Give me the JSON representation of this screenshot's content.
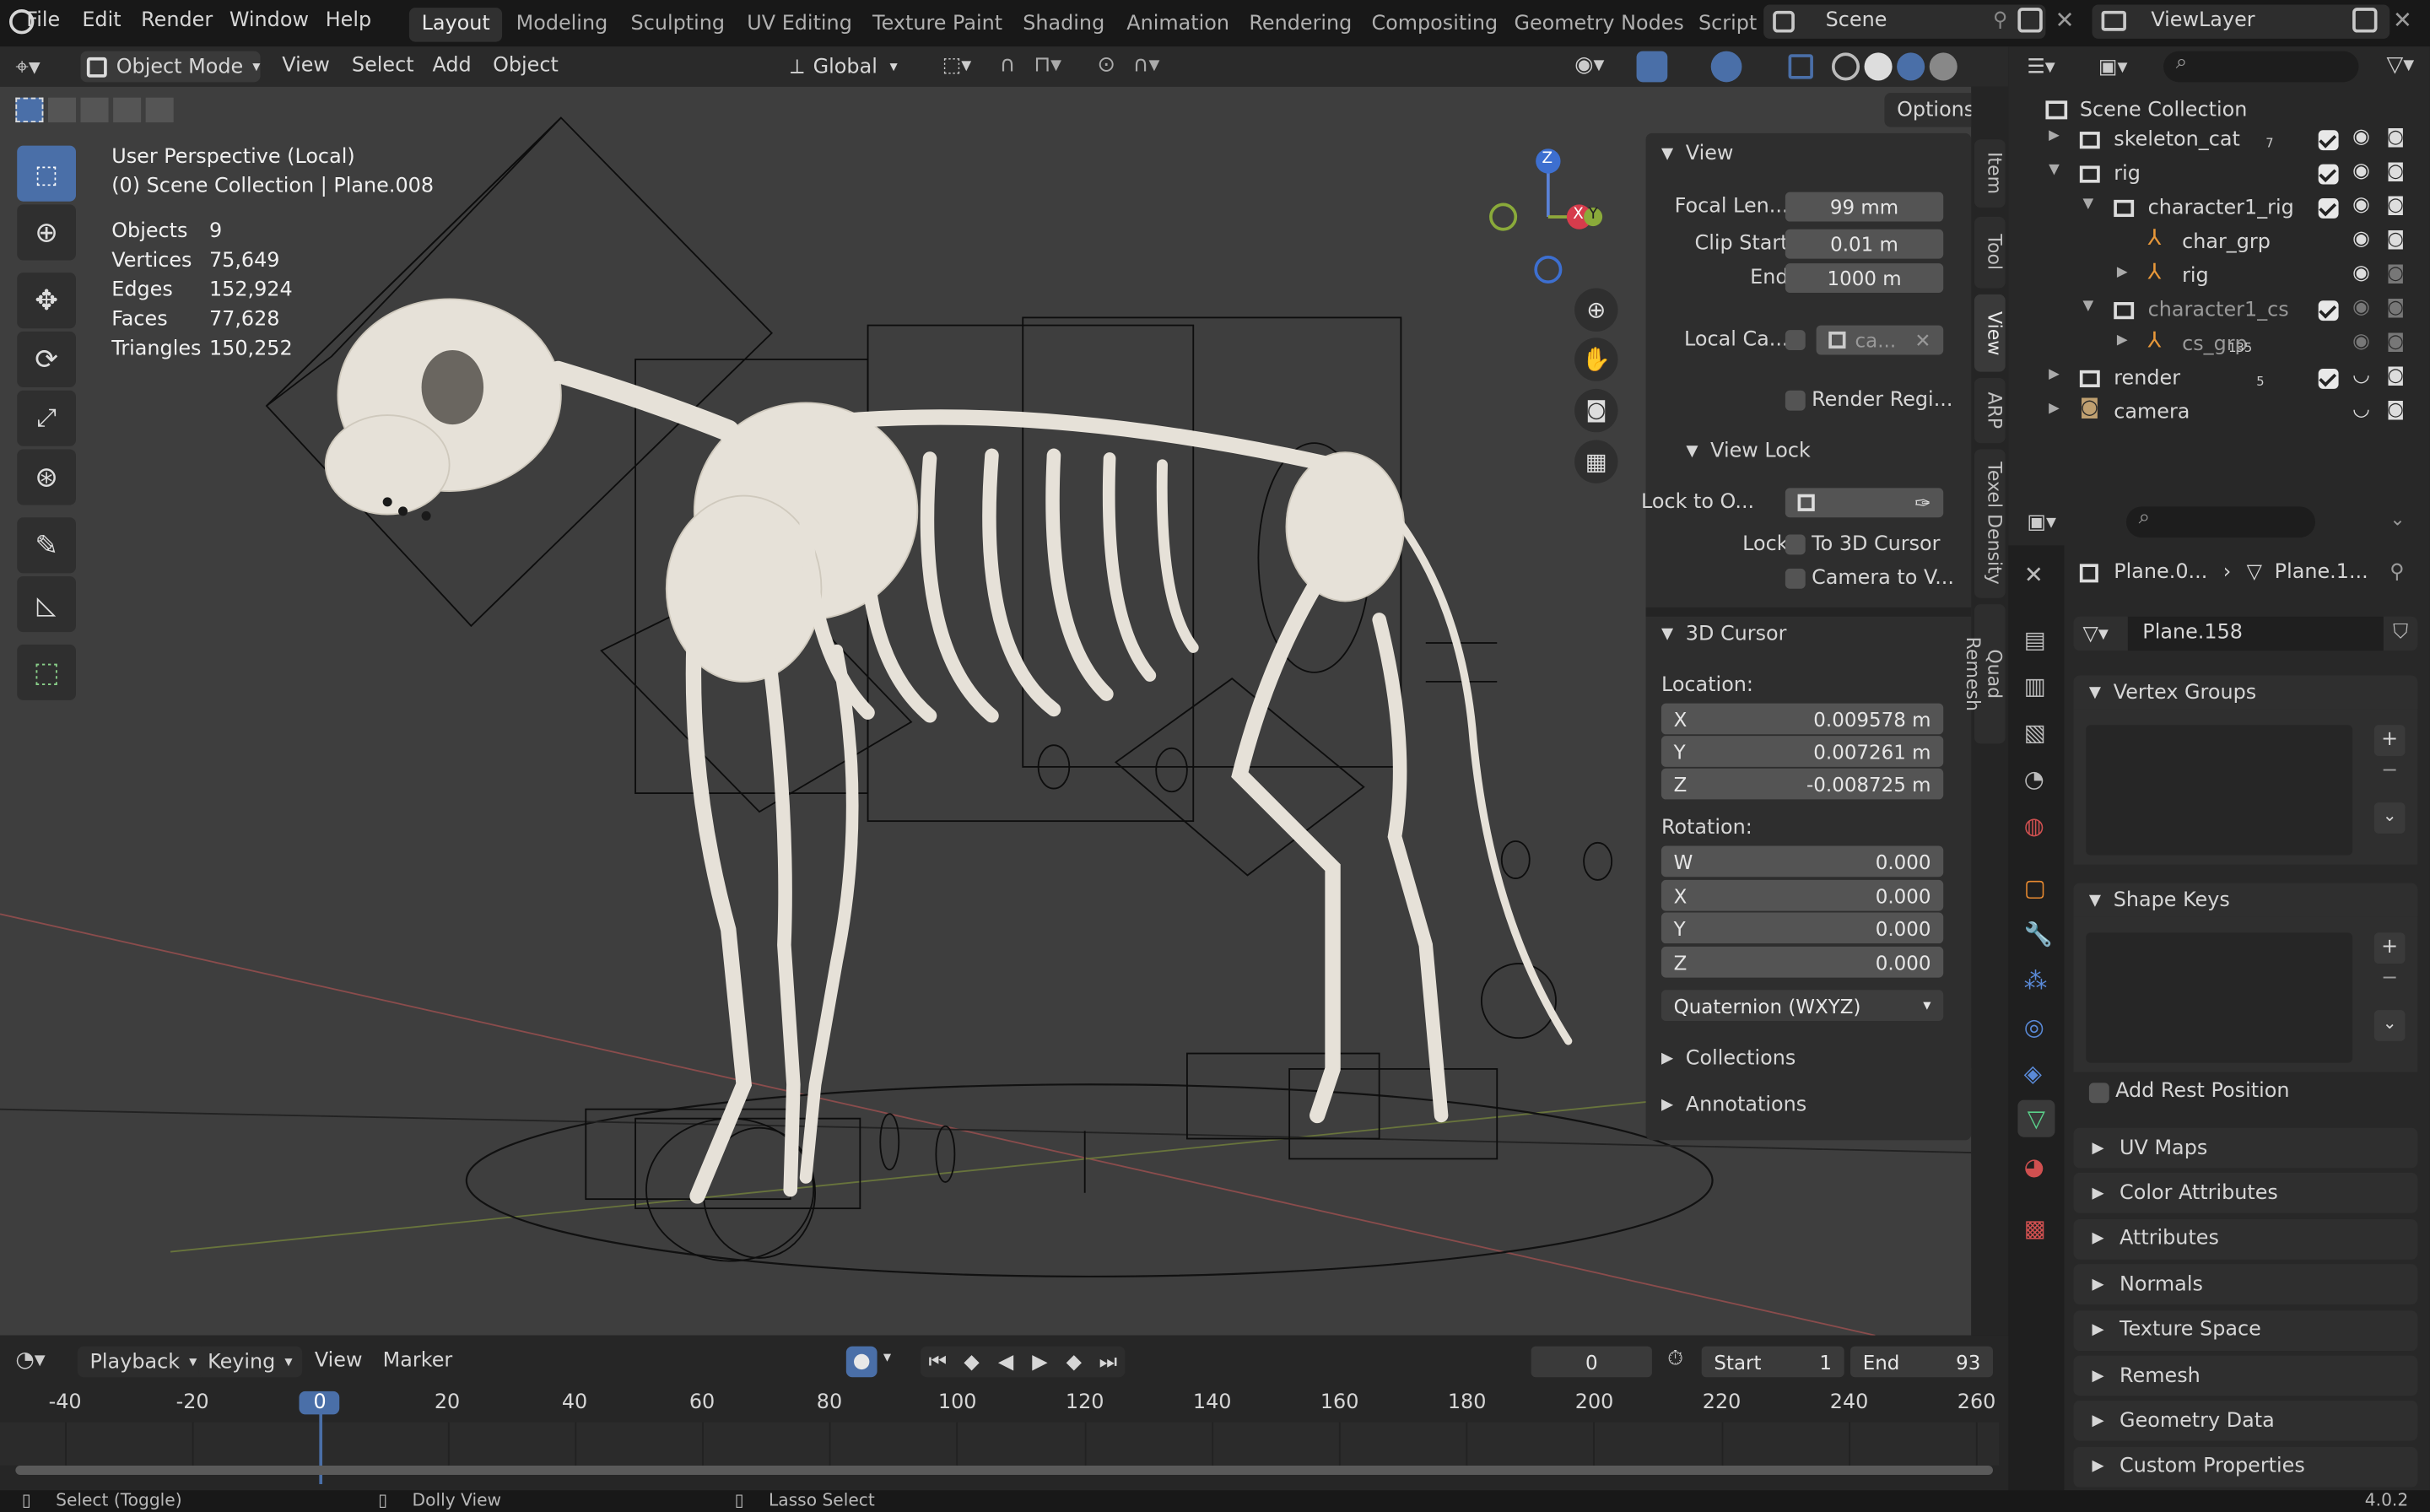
{
  "menus": [
    "File",
    "Edit",
    "Render",
    "Window",
    "Help"
  ],
  "workspaces": [
    "Layout",
    "Modeling",
    "Sculpting",
    "UV Editing",
    "Texture Paint",
    "Shading",
    "Animation",
    "Rendering",
    "Compositing",
    "Geometry Nodes",
    "Script"
  ],
  "scene": "Scene",
  "view_layer": "ViewLayer",
  "vp_header": {
    "mode": "Object Mode",
    "view": "View",
    "select": "Select",
    "add": "Add",
    "object": "Object",
    "orientation": "Global",
    "options": "Options"
  },
  "overlay": {
    "line1": "User Perspective (Local)",
    "line2": "(0) Scene Collection | Plane.008",
    "stats": [
      [
        "Objects",
        "9"
      ],
      [
        "Vertices",
        "75,649"
      ],
      [
        "Edges",
        "152,924"
      ],
      [
        "Faces",
        "77,628"
      ],
      [
        "Triangles",
        "150,252"
      ]
    ]
  },
  "gizmo": {
    "z": "Z",
    "x": "X",
    "y": "Y"
  },
  "npanel": {
    "view_title": "View",
    "focal_label": "Focal Len...",
    "focal": "99 mm",
    "clip_start_label": "Clip Start",
    "clip_start": "0.01 m",
    "end_label": "End",
    "clip_end": "1000 m",
    "local_cam_label": "Local Ca...",
    "local_cam": "ca...",
    "render_region": "Render Regi...",
    "view_lock": "View Lock",
    "lock_to_label": "Lock to O...",
    "lock_label": "Lock",
    "to_cursor": "To 3D Cursor",
    "cam_to_view": "Camera to V...",
    "cursor_title": "3D Cursor",
    "location": "Location:",
    "loc": [
      [
        "X",
        "0.009578 m"
      ],
      [
        "Y",
        "0.007261 m"
      ],
      [
        "Z",
        "-0.008725 m"
      ]
    ],
    "rotation": "Rotation:",
    "rot": [
      [
        "W",
        "0.000"
      ],
      [
        "X",
        "0.000"
      ],
      [
        "Y",
        "0.000"
      ],
      [
        "Z",
        "0.000"
      ]
    ],
    "rot_mode": "Quaternion (WXYZ)",
    "collections": "Collections",
    "annotations": "Annotations"
  },
  "side_tabs": [
    "Item",
    "Tool",
    "View",
    "ARP",
    "Texel Density",
    "Quad Remesh"
  ],
  "outliner": {
    "root": "Scene Collection",
    "rows": [
      {
        "label": "skeleton_cat",
        "indent": 0,
        "badge": "7"
      },
      {
        "label": "rig",
        "indent": 0,
        "badge": ""
      },
      {
        "label": "character1_rig",
        "indent": 1,
        "badge": ""
      },
      {
        "label": "char_grp",
        "indent": 2,
        "badge": ""
      },
      {
        "label": "rig",
        "indent": 2,
        "badge": ""
      },
      {
        "label": "character1_cs",
        "indent": 1,
        "badge": ""
      },
      {
        "label": "cs_grp",
        "indent": 2,
        "badge": "135"
      },
      {
        "label": "render",
        "indent": 0,
        "badge": "5"
      },
      {
        "label": "camera",
        "indent": 0,
        "badge": ""
      }
    ]
  },
  "props": {
    "crumb1": "Plane.0...",
    "crumb2": "Plane.1...",
    "mesh_name": "Plane.158",
    "vertex_groups": "Vertex Groups",
    "shape_keys": "Shape Keys",
    "add_rest": "Add Rest Position",
    "sections": [
      "UV Maps",
      "Color Attributes",
      "Attributes",
      "Normals",
      "Texture Space",
      "Remesh",
      "Geometry Data",
      "Custom Properties"
    ]
  },
  "timeline": {
    "playback": "Playback",
    "keying": "Keying",
    "view": "View",
    "marker": "Marker",
    "frame": "0",
    "start_label": "Start",
    "start": "1",
    "end_label": "End",
    "end": "93",
    "ticks": [
      "-40",
      "-20",
      "0",
      "20",
      "40",
      "60",
      "80",
      "100",
      "120",
      "140",
      "160",
      "180",
      "200",
      "220",
      "240",
      "260"
    ]
  },
  "status": {
    "select": "Select (Toggle)",
    "dolly": "Dolly View",
    "lasso": "Lasso Select",
    "version": "4.0.2"
  }
}
